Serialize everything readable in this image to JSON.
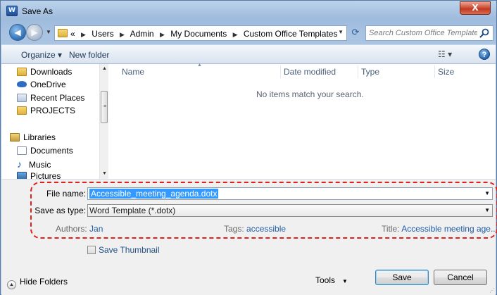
{
  "window": {
    "title": "Save As",
    "app_icon_text": "W",
    "close_label": "X"
  },
  "address": {
    "overflow_chevron": "«",
    "crumbs": [
      "Users",
      "Admin",
      "My Documents",
      "Custom Office Templates"
    ],
    "search_placeholder": "Search Custom Office Templates"
  },
  "toolbar": {
    "organize_label": "Organize ▾",
    "new_folder_label": "New folder",
    "views_label": "☷ ▾",
    "help_label": "?"
  },
  "nav_pane": {
    "items": [
      {
        "label": "Downloads",
        "icon": "downloads-folder-icon"
      },
      {
        "label": "OneDrive",
        "icon": "onedrive-cloud-icon"
      },
      {
        "label": "Recent Places",
        "icon": "recent-places-icon"
      },
      {
        "label": "PROJECTS",
        "icon": "folder-icon"
      },
      {
        "label": "Libraries",
        "icon": "libraries-icon"
      },
      {
        "label": "Documents",
        "icon": "documents-icon"
      },
      {
        "label": "Music",
        "icon": "music-icon"
      },
      {
        "label": "Pictures",
        "icon": "pictures-icon"
      }
    ]
  },
  "file_list": {
    "columns": [
      "Name",
      "Date modified",
      "Type",
      "Size"
    ],
    "empty_message": "No items match your search."
  },
  "form": {
    "file_name_label": "File name:",
    "file_name_value": "Accessible_meeting_agenda.dotx",
    "save_type_label": "Save as type:",
    "save_type_value": "Word Template (*.dotx)",
    "authors_label": "Authors:",
    "authors_value": "Jan",
    "tags_label": "Tags:",
    "tags_value": "accessible",
    "title_label": "Title:",
    "title_value": "Accessible meeting age...",
    "save_thumbnail_label": "Save Thumbnail"
  },
  "footer": {
    "hide_folders_label": "Hide Folders",
    "tools_label": "Tools",
    "save_label": "Save",
    "cancel_label": "Cancel"
  },
  "colors": {
    "highlight_outline": "#e0201b",
    "selection": "#3399ff",
    "link_blue": "#1f5da8"
  }
}
